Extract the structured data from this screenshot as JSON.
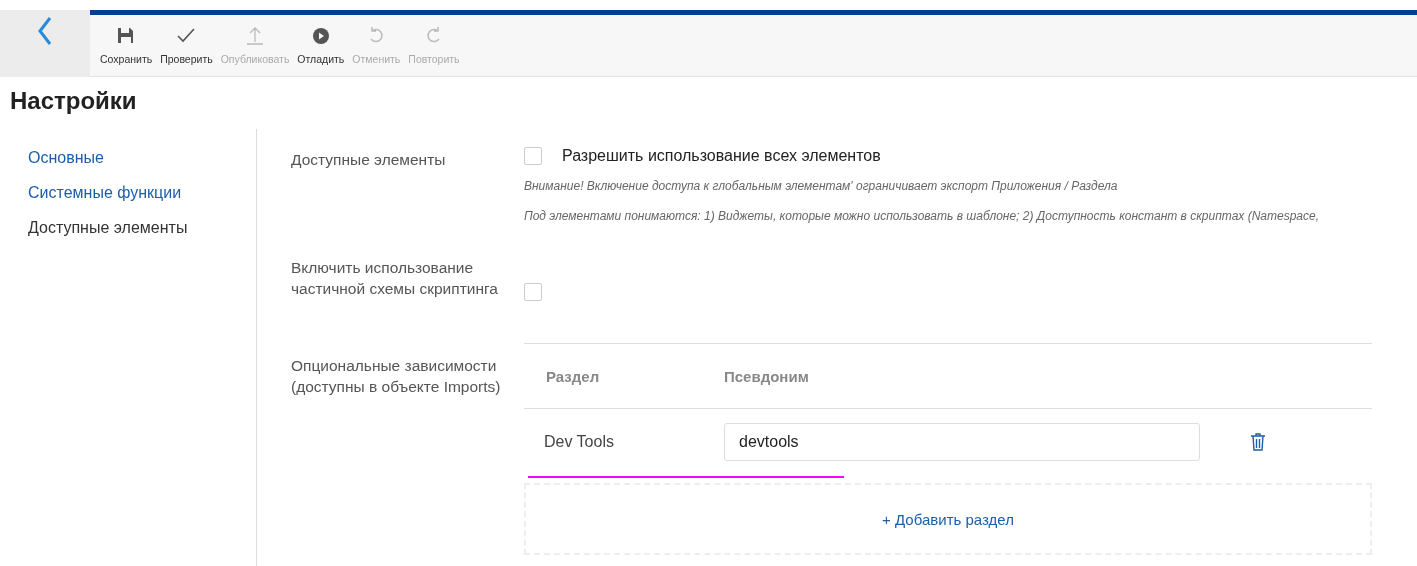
{
  "toolbar": {
    "items": [
      {
        "kind": "save",
        "label": "Сохранить",
        "disabled": false
      },
      {
        "kind": "check",
        "label": "Проверить",
        "disabled": false
      },
      {
        "kind": "publish",
        "label": "Опубликовать",
        "disabled": true
      },
      {
        "kind": "debug",
        "label": "Отладить",
        "disabled": false
      },
      {
        "kind": "undo",
        "label": "Отменить",
        "disabled": true
      },
      {
        "kind": "redo",
        "label": "Повторить",
        "disabled": true
      }
    ]
  },
  "title": "Настройки",
  "sidebar": {
    "items": [
      {
        "label": "Основные",
        "selected": false
      },
      {
        "label": "Системные функции",
        "selected": false
      },
      {
        "label": "Доступные элементы",
        "selected": true
      }
    ]
  },
  "settings": {
    "available_elements": {
      "label": "Доступные элементы",
      "checkbox_label": "Разрешить использование всех элементов",
      "checked": false,
      "notes": [
        "Внимание! Включение доступа к глобальным элементам' ограничивает экспорт Приложения / Раздела",
        "Под элементами понимаются: 1) Виджеты, которые можно использовать в шаблоне; 2) Доступность констант в скриптах (Namespace,"
      ]
    },
    "partial_scripting": {
      "label": "Включить использование частичной схемы скриптинга",
      "checked": false
    },
    "optional_dependencies": {
      "label": "Опциональные зависимости (доступны в объекте Imports)",
      "table": {
        "columns": [
          "Раздел",
          "Псевдоним"
        ],
        "rows": [
          {
            "section": "Dev Tools",
            "alias": "devtools"
          }
        ]
      },
      "add_button": "+ Добавить раздел"
    }
  }
}
